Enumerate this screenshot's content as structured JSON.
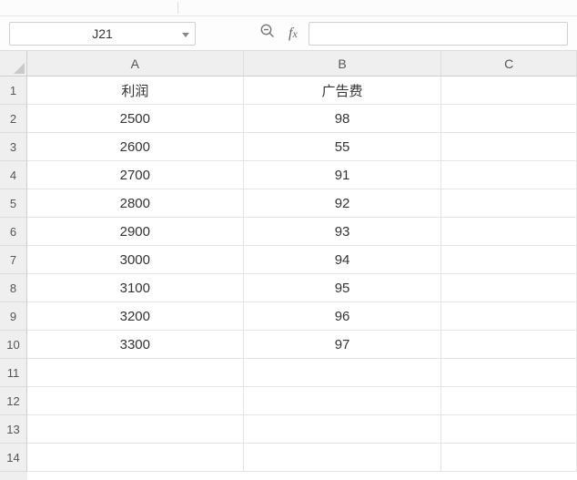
{
  "name_box": {
    "value": "J21"
  },
  "formula_bar": {
    "value": ""
  },
  "columns": [
    {
      "id": "A",
      "label": "A"
    },
    {
      "id": "B",
      "label": "B"
    },
    {
      "id": "C",
      "label": "C"
    }
  ],
  "row_count": 14,
  "cells": {
    "r1": {
      "A": "利润",
      "B": "广告费",
      "C": ""
    },
    "r2": {
      "A": "2500",
      "B": "98",
      "C": ""
    },
    "r3": {
      "A": "2600",
      "B": "55",
      "C": ""
    },
    "r4": {
      "A": "2700",
      "B": "91",
      "C": ""
    },
    "r5": {
      "A": "2800",
      "B": "92",
      "C": ""
    },
    "r6": {
      "A": "2900",
      "B": "93",
      "C": ""
    },
    "r7": {
      "A": "3000",
      "B": "94",
      "C": ""
    },
    "r8": {
      "A": "3100",
      "B": "95",
      "C": ""
    },
    "r9": {
      "A": "3200",
      "B": "96",
      "C": ""
    },
    "r10": {
      "A": "3300",
      "B": "97",
      "C": ""
    },
    "r11": {
      "A": "",
      "B": "",
      "C": ""
    },
    "r12": {
      "A": "",
      "B": "",
      "C": ""
    },
    "r13": {
      "A": "",
      "B": "",
      "C": ""
    },
    "r14": {
      "A": "",
      "B": "",
      "C": ""
    }
  },
  "chart_data": {
    "type": "table",
    "title": "",
    "columns": [
      "利润",
      "广告费"
    ],
    "rows": [
      [
        2500,
        98
      ],
      [
        2600,
        55
      ],
      [
        2700,
        91
      ],
      [
        2800,
        92
      ],
      [
        2900,
        93
      ],
      [
        3000,
        94
      ],
      [
        3100,
        95
      ],
      [
        3200,
        96
      ],
      [
        3300,
        97
      ]
    ]
  }
}
